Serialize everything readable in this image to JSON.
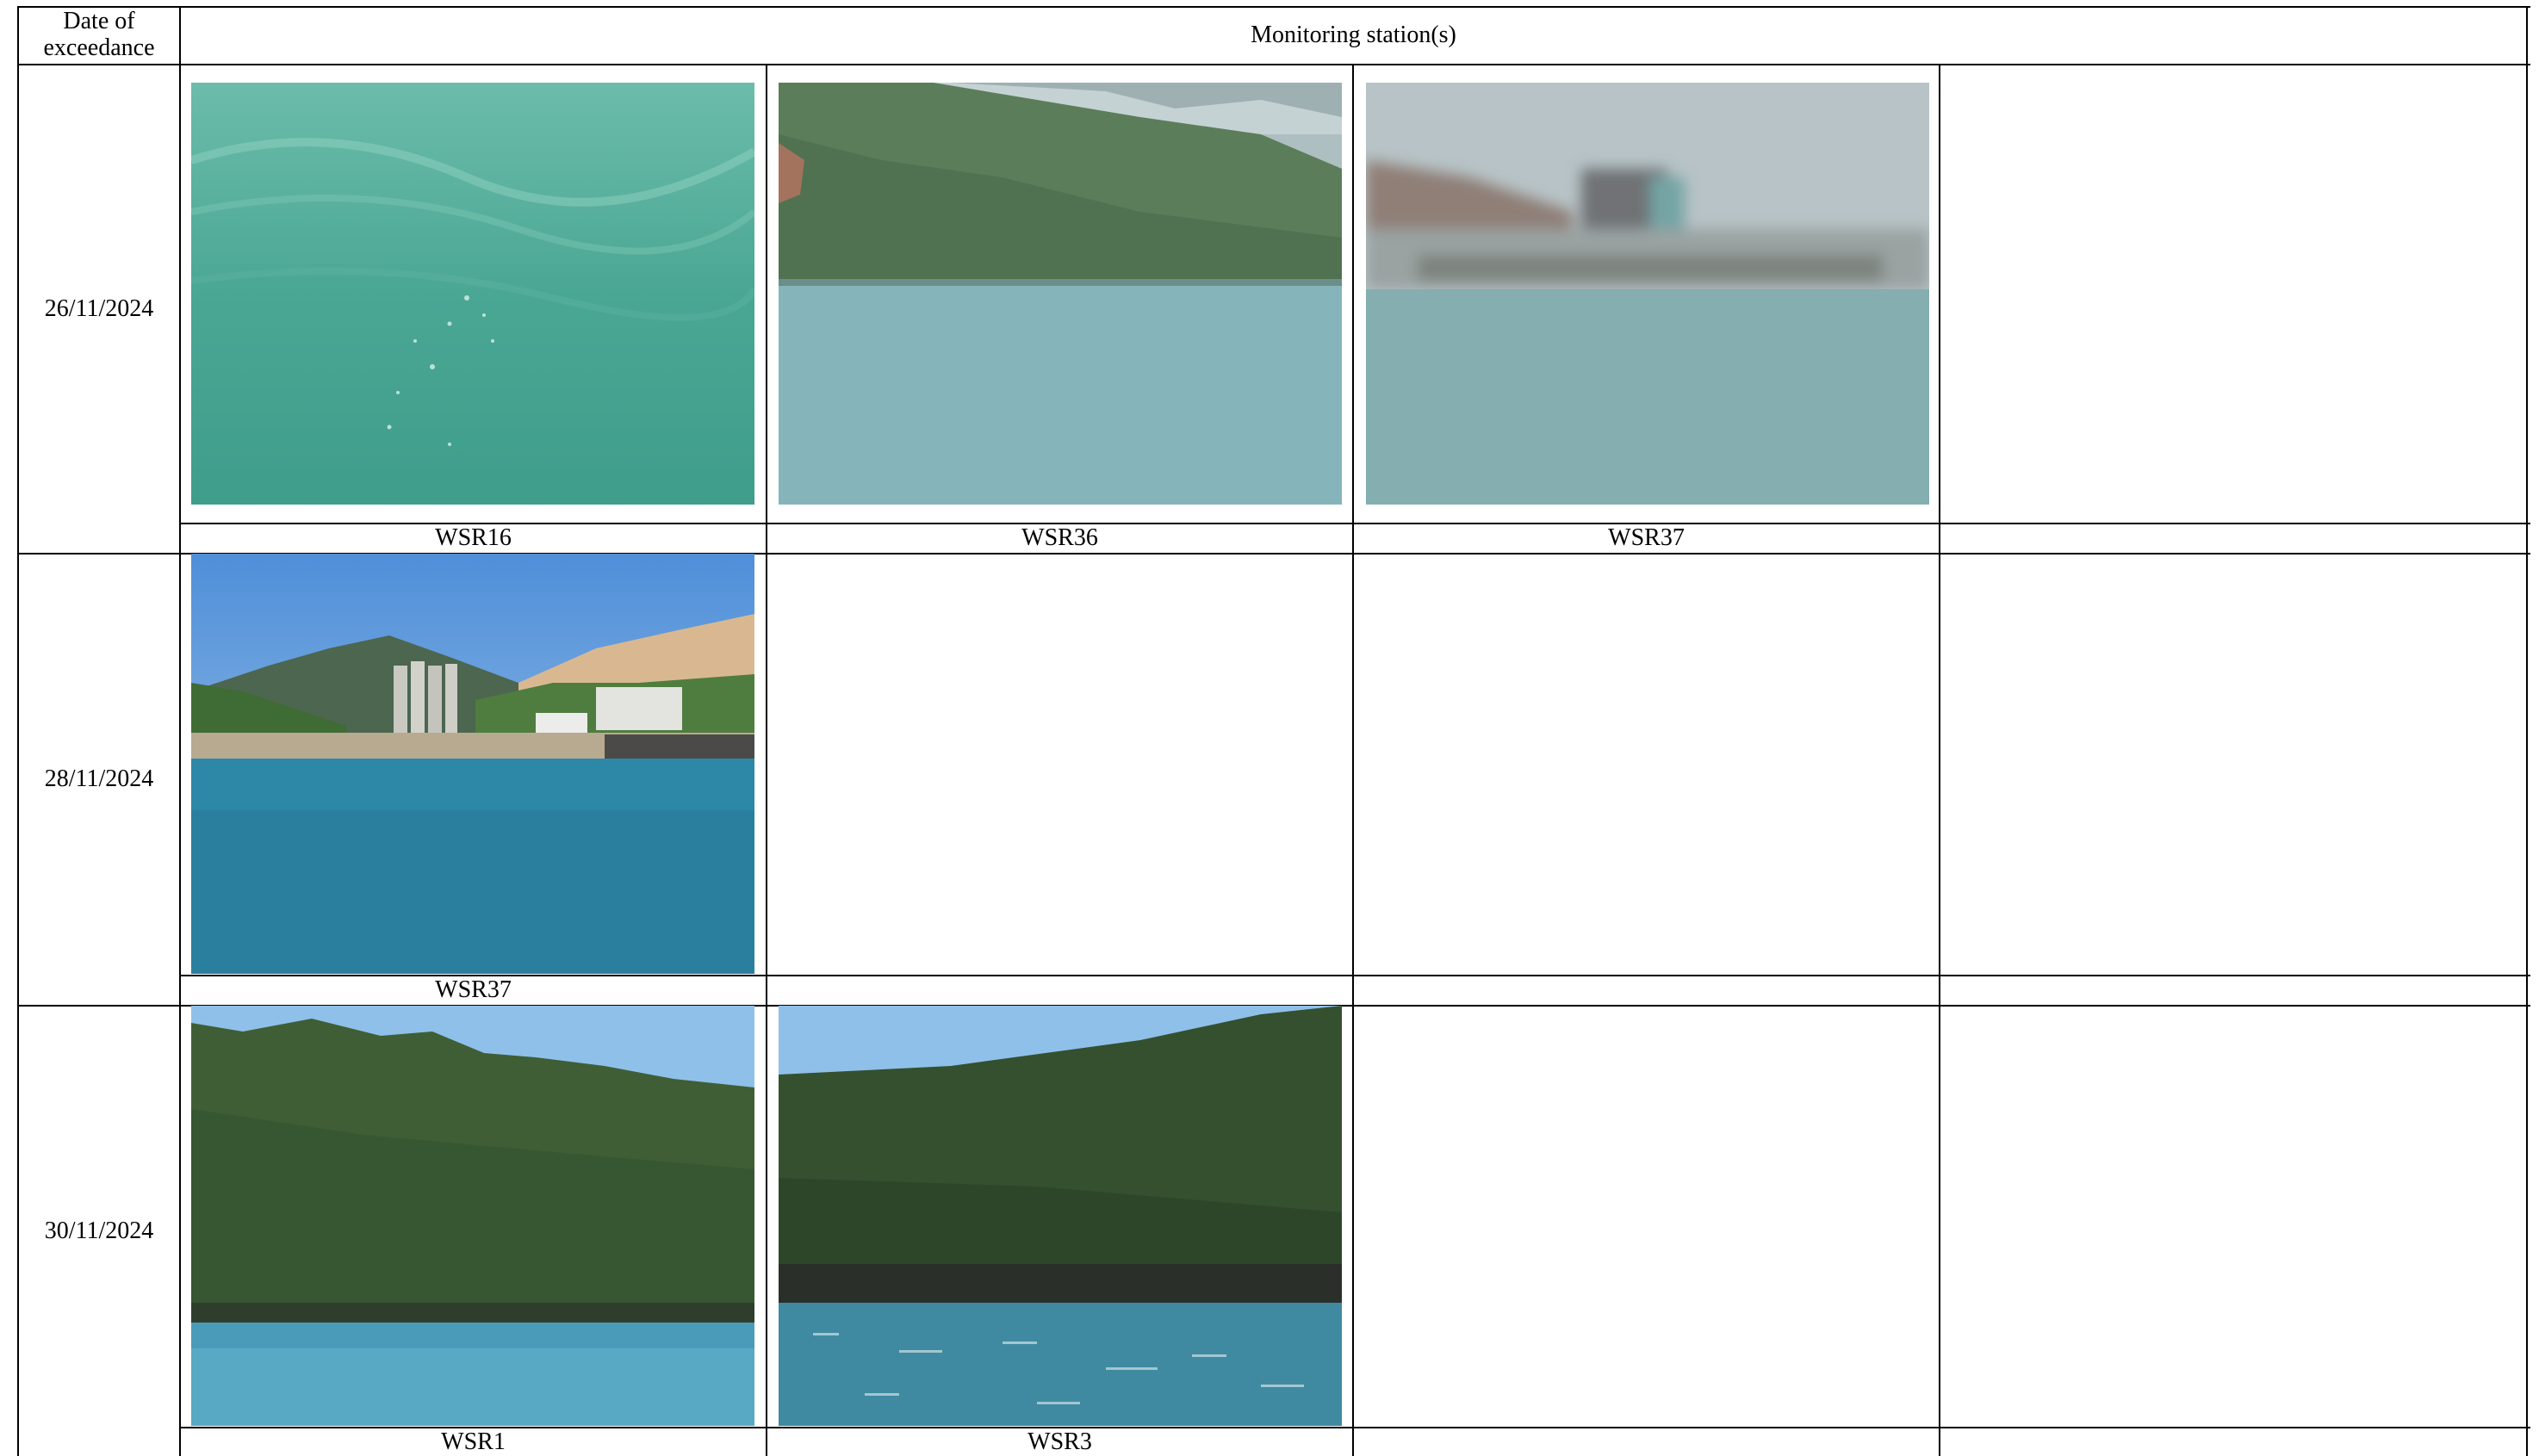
{
  "table": {
    "header": {
      "date_col_line1": "Date of",
      "date_col_line2": "exceedance",
      "stations_col": "Monitoring station(s)"
    },
    "rows": [
      {
        "date": "26/11/2024",
        "stations": [
          {
            "label": "WSR16",
            "photo": "sea-surface-photo"
          },
          {
            "label": "WSR36",
            "photo": "hillside-and-sea-photo"
          },
          {
            "label": "WSR37",
            "photo": "blurred-shoreline-photo"
          },
          {
            "label": "",
            "photo": ""
          }
        ]
      },
      {
        "date": "28/11/2024",
        "stations": [
          {
            "label": "WSR37",
            "photo": "coastal-towers-and-seawall-photo"
          },
          {
            "label": "",
            "photo": ""
          },
          {
            "label": "",
            "photo": ""
          },
          {
            "label": "",
            "photo": ""
          }
        ]
      },
      {
        "date": "30/11/2024",
        "stations": [
          {
            "label": "WSR1",
            "photo": "green-hills-and-sea-photo"
          },
          {
            "label": "WSR3",
            "photo": "wooded-cliff-and-sea-photo"
          },
          {
            "label": "",
            "photo": ""
          },
          {
            "label": "",
            "photo": ""
          }
        ]
      }
    ]
  }
}
